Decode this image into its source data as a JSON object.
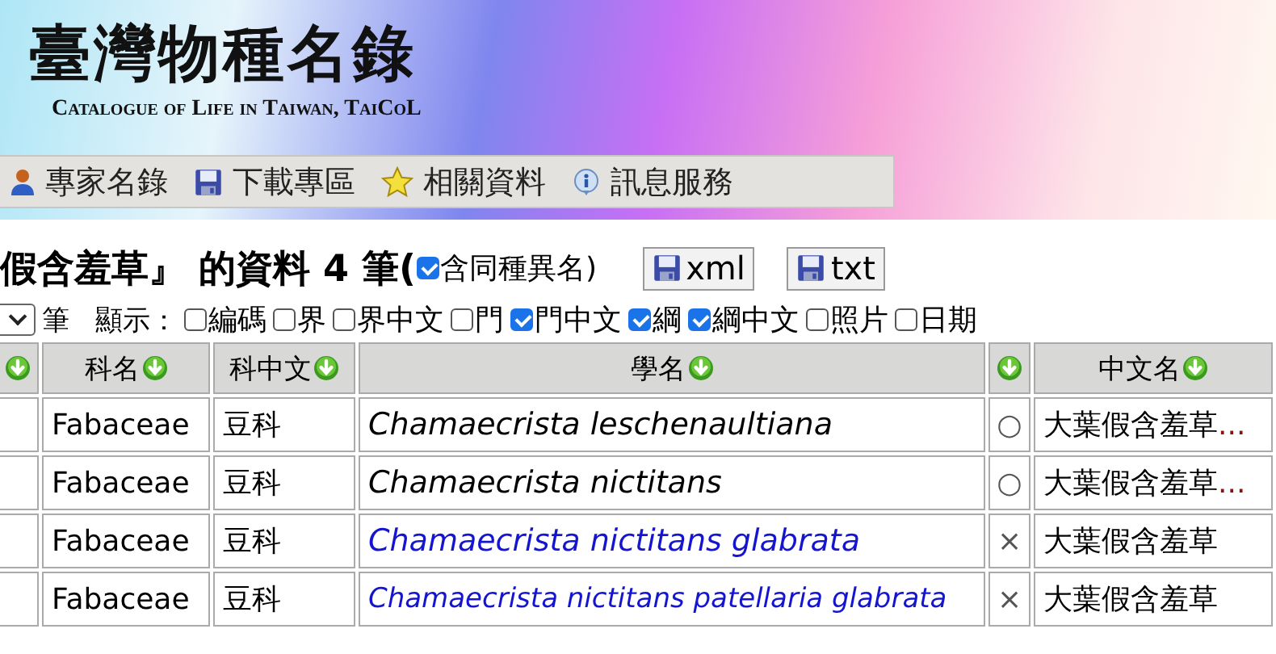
{
  "header": {
    "logo_title": "臺灣物種名錄",
    "logo_subtitle": "Catalogue of Life in Taiwan, TaiCoL"
  },
  "menu": [
    {
      "kind": "person",
      "label": "專家名錄"
    },
    {
      "kind": "disk",
      "label": "下載專區"
    },
    {
      "kind": "star",
      "label": "相關資料"
    },
    {
      "kind": "info",
      "label": "訊息服務"
    }
  ],
  "result": {
    "title": "假含羞草』 的資料 4 筆(",
    "include_synonyms": {
      "label": "含同種異名)",
      "checked": true
    },
    "export_buttons": [
      "xml",
      "txt"
    ]
  },
  "options": {
    "page_size_suffix": "筆",
    "display_label": "顯示：",
    "fields": [
      {
        "label": "編碼",
        "checked": false
      },
      {
        "label": "界",
        "checked": false
      },
      {
        "label": "界中文",
        "checked": false
      },
      {
        "label": "門",
        "checked": false
      },
      {
        "label": "門中文",
        "checked": true
      },
      {
        "label": "綱",
        "checked": true
      },
      {
        "label": "綱中文",
        "checked": true
      },
      {
        "label": "照片",
        "checked": false
      },
      {
        "label": "日期",
        "checked": false
      }
    ]
  },
  "table": {
    "columns": [
      {},
      {
        "label": "科名"
      },
      {
        "label": "科中文"
      },
      {
        "label": "學名"
      },
      {},
      {
        "label": "中文名"
      }
    ],
    "rows": [
      {
        "family": "Fabaceae",
        "family_zh": "豆科",
        "scientific_name": "Chamaecrista leschenaultiana",
        "link": false,
        "status": "○",
        "common_name": "大葉假含羞草",
        "more": "..."
      },
      {
        "family": "Fabaceae",
        "family_zh": "豆科",
        "scientific_name": "Chamaecrista nictitans",
        "link": false,
        "status": "○",
        "common_name": "大葉假含羞草",
        "more": "..."
      },
      {
        "family": "Fabaceae",
        "family_zh": "豆科",
        "scientific_name": "Chamaecrista nictitans glabrata",
        "link": true,
        "status": "×",
        "common_name": "大葉假含羞草"
      },
      {
        "family": "Fabaceae",
        "family_zh": "豆科",
        "scientific_name": "Chamaecrista nictitans patellaria glabrata",
        "link": true,
        "status": "×",
        "common_name": "大葉假含羞草"
      }
    ]
  }
}
